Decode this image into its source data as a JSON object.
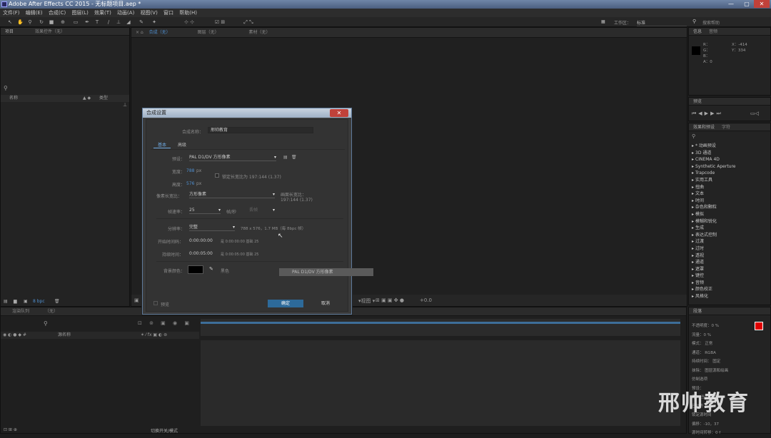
{
  "titlebar": {
    "title": "Adobe After Effects CC 2015 - 无标题项目.aep *",
    "min": "—",
    "max": "▢",
    "close": "✕"
  },
  "menu": [
    "文件(F)",
    "编辑(E)",
    "合成(C)",
    "图层(L)",
    "效果(T)",
    "动画(A)",
    "视图(V)",
    "窗口",
    "帮助(H)"
  ],
  "toolbar": {
    "workspace_label": "工作区：",
    "workspace_value": "标准",
    "search_placeholder": "搜索帮助"
  },
  "left_panel": {
    "tab_project": "项目",
    "tab_effects": "效果控件（无）",
    "col_name": "名称",
    "col_type": "类型",
    "bpc": "8 bpc"
  },
  "comp_viewer": {
    "tab_comp": "合成（无）",
    "tab_layer": "图层（无）",
    "tab_footage": "素材（无）",
    "zoom": "+0.0"
  },
  "info_panel": {
    "tab_info": "信息",
    "tab_audio": "音频",
    "r": "R：",
    "g": "G：",
    "b": "B：",
    "a": "A：0",
    "x": "X：-414",
    "y": "Y：334"
  },
  "preview_panel": {
    "tab": "预览"
  },
  "effects_panel": {
    "tab_effects": "效果和预设",
    "tab_char": "字符",
    "items": [
      "* 动画预设",
      "3D 通道",
      "CINEMA 4D",
      "Synthetic Aperture",
      "Trapcode",
      "实用工具",
      "扭曲",
      "文本",
      "时间",
      "杂色和颗粒",
      "模拟",
      "模糊和锐化",
      "生成",
      "表达式控制",
      "过渡",
      "过时",
      "透视",
      "通道",
      "遮罩",
      "键控",
      "音频",
      "颜色校正",
      "风格化"
    ]
  },
  "paragraph_panel": {
    "tab": "段落",
    "opacity": "不透明度：0 %",
    "flow": "流量：0 %",
    "mode_label": "模式：",
    "mode_value": "正常",
    "channel_label": "通道：",
    "channel_value": "RGBA",
    "duration_label": "持续时间：",
    "duration_value": "固定",
    "erase_label": "抹除：",
    "erase_value": "图层源和绘画",
    "brush_tip": "仿制选项",
    "preset_label": "预设：",
    "source_label": "源：",
    "source_value": "当前图层",
    "aligned": "已对齐",
    "lock_source": "锁定源时间",
    "offset": "偏移：-10，37",
    "source_time": "源时间转移：0 f"
  },
  "timeline": {
    "tab": "渲染队列",
    "tab_none": "（无）",
    "col_layer": "源名称",
    "switch_mode": "切换开关/模式"
  },
  "dialog": {
    "title": "合成设置",
    "close": "✕",
    "name_label": "合成名称：",
    "name_value": "邢帅教育",
    "tab_basic": "基本",
    "tab_advanced": "高级",
    "preset_label": "预设：",
    "preset_value": "PAL D1/DV 方形像素",
    "width_label": "宽度：",
    "width_value": "788",
    "width_unit": "px",
    "height_label": "高度：",
    "height_value": "576",
    "height_unit": "px",
    "lock_aspect": "锁定长宽比为 197:144 (1.37)",
    "pixel_aspect_label": "像素长宽比：",
    "pixel_aspect_value": "方形像素",
    "frame_aspect_label": "画面长宽比：",
    "frame_aspect_value": "197:144 (1.37)",
    "fps_label": "帧速率：",
    "fps_value": "25",
    "fps_unit": "帧/秒",
    "drop_frame": "丢帧",
    "resolution_label": "分辨率：",
    "resolution_value": "完整",
    "resolution_info": "788 x 576，1.7 MB（每 8bpc 帧）",
    "start_tc_label": "开始时间码：",
    "start_tc_value": "0:00:00:00",
    "start_tc_info": "是 0:00:00:00  基础 25",
    "duration_label": "持续时间：",
    "duration_value": "0:00:05:00",
    "duration_info": "是 0:00:05:00  基础 25",
    "bg_color_label": "背景颜色：",
    "bg_color_name": "黑色",
    "preview": "预览",
    "ok": "确定",
    "cancel": "取消",
    "tooltip": "PAL D1/DV 方形像素"
  },
  "watermark": "邢帅教育",
  "colors": {
    "accent": "#2d6a9a",
    "swatch_red": "#e00000"
  }
}
